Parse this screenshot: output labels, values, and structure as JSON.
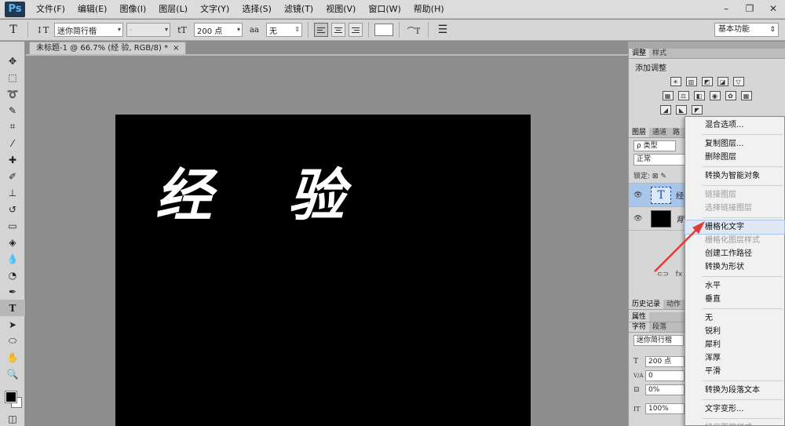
{
  "app": {
    "logo": "Ps"
  },
  "menu": [
    "文件(F)",
    "编辑(E)",
    "图像(I)",
    "图层(L)",
    "文字(Y)",
    "选择(S)",
    "滤镜(T)",
    "视图(V)",
    "窗口(W)",
    "帮助(H)"
  ],
  "window_controls": {
    "minimize": "–",
    "restore": "❐",
    "close": "✕"
  },
  "options": {
    "text_tool_icon": "T",
    "orient_icon": "↕T",
    "font_family": "迷你简行楷",
    "font_style": "-",
    "size_icon": "tT",
    "font_size": "200 点",
    "aa_icon": "aa",
    "antialias": "无",
    "warp_icon": "⌒T",
    "panel_icon": "☰",
    "workspace": "基本功能"
  },
  "document": {
    "tab_title": "未标题-1 @ 66.7% (经 验, RGB/8) *",
    "tab_close": "×",
    "canvas_text": "经 验"
  },
  "panels": {
    "top_tabs": [
      "调整",
      "样式"
    ],
    "adjust_title": "添加调整",
    "layers_tabs": [
      "图层",
      "通道",
      "路"
    ],
    "filter_label": "ρ 类型",
    "blend_mode": "正常",
    "lock_label": "锁定:",
    "layers": [
      {
        "thumb": "T",
        "name": "经"
      },
      {
        "thumb": "",
        "name": "背"
      }
    ],
    "lower_tabs": [
      "历史记录",
      "动作"
    ],
    "props_tab": "属性",
    "char_tabs": [
      "字符",
      "段落"
    ],
    "char_font": "迷你简行楷",
    "char_rows": [
      {
        "icon": "T",
        "value": "200 点"
      },
      {
        "icon": "V/A",
        "value": "0"
      },
      {
        "icon": "⊡",
        "value": "0%"
      },
      {
        "icon": "IT",
        "value": "100%"
      }
    ]
  },
  "context_menu": {
    "items": [
      {
        "label": "混合选项...",
        "state": "normal"
      },
      {
        "sep": true
      },
      {
        "label": "复制图层...",
        "state": "normal"
      },
      {
        "label": "删除图层",
        "state": "normal"
      },
      {
        "sep": true
      },
      {
        "label": "转换为智能对象",
        "state": "normal"
      },
      {
        "sep": true
      },
      {
        "label": "链接图层",
        "state": "disabled"
      },
      {
        "label": "选择链接图层",
        "state": "disabled"
      },
      {
        "sep": true
      },
      {
        "label": "栅格化文字",
        "state": "hover"
      },
      {
        "label": "栅格化图层样式",
        "state": "disabled"
      },
      {
        "label": "创建工作路径",
        "state": "normal"
      },
      {
        "label": "转换为形状",
        "state": "normal"
      },
      {
        "sep": true
      },
      {
        "label": "水平",
        "state": "normal"
      },
      {
        "label": "垂直",
        "state": "normal"
      },
      {
        "sep": true
      },
      {
        "label": "无",
        "state": "normal"
      },
      {
        "label": "锐利",
        "state": "normal"
      },
      {
        "label": "犀利",
        "state": "normal"
      },
      {
        "label": "浑厚",
        "state": "normal"
      },
      {
        "label": "平滑",
        "state": "normal"
      },
      {
        "sep": true
      },
      {
        "label": "转换为段落文本",
        "state": "normal"
      },
      {
        "sep": true
      },
      {
        "label": "文字变形...",
        "state": "normal"
      },
      {
        "sep": true
      },
      {
        "label": "拷贝图层样式",
        "state": "disabled"
      }
    ]
  },
  "colors": {
    "annotation_arrow": "#e23b3b",
    "selected_layer": "#a9c6ea",
    "canvas": "#000000"
  }
}
